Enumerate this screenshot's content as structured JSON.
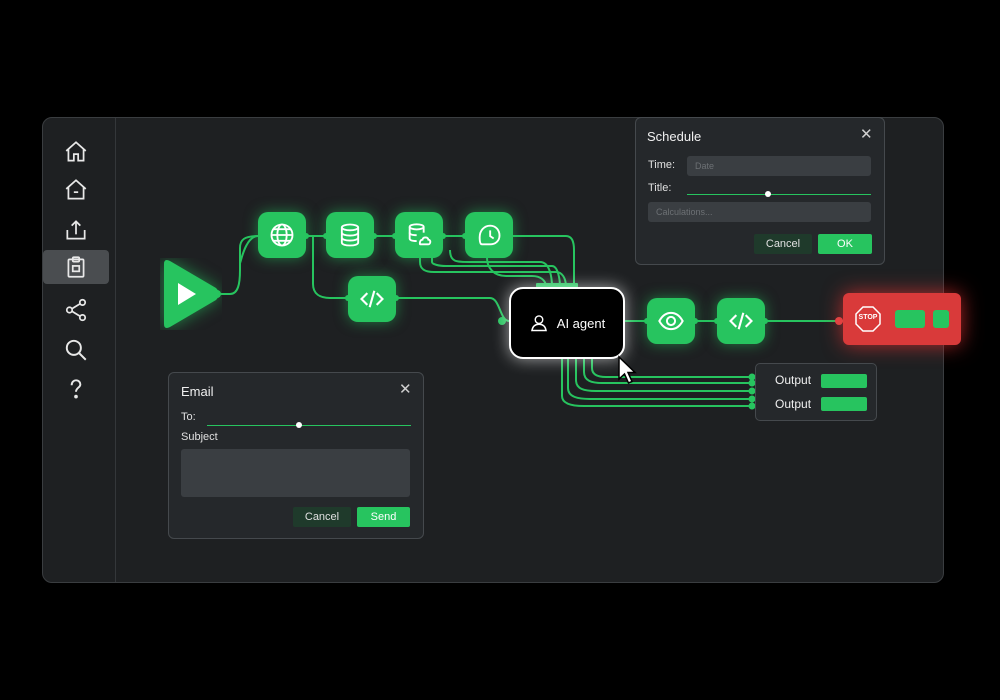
{
  "sidebar": {
    "items": [
      {
        "icon": "home-icon"
      },
      {
        "icon": "workspace-icon"
      },
      {
        "icon": "upload-icon"
      },
      {
        "icon": "clipboard-icon"
      },
      {
        "icon": "share-icon"
      },
      {
        "icon": "search-icon"
      },
      {
        "icon": "help-icon"
      }
    ]
  },
  "flow": {
    "ai_node_label": "AI agent",
    "stop_label": "STOP",
    "outputs": [
      {
        "label": "Output"
      },
      {
        "label": "Output"
      }
    ]
  },
  "schedule": {
    "title": "Schedule",
    "time_label": "Time:",
    "time_placeholder": "Date",
    "title_label": "Title:",
    "title_placeholder": "Calculations...",
    "cancel": "Cancel",
    "ok": "OK"
  },
  "email": {
    "title": "Email",
    "to_label": "To:",
    "subject_label": "Subject",
    "cancel": "Cancel",
    "send": "Send"
  },
  "colors": {
    "accent": "#27c45f",
    "stop": "#d93a3a",
    "background": "#1e2022"
  }
}
